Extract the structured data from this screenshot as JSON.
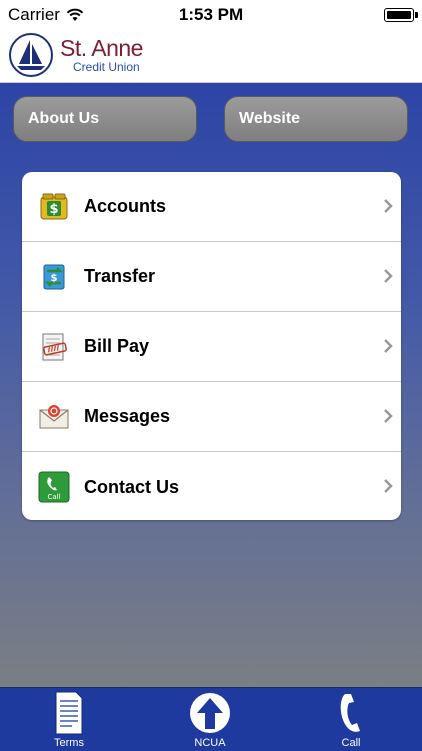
{
  "status": {
    "carrier": "Carrier",
    "time": "1:53 PM"
  },
  "header": {
    "title": "St. Anne",
    "subtitle": "Credit Union"
  },
  "buttons": {
    "about": "About Us",
    "website": "Website"
  },
  "menu": [
    {
      "label": "Accounts",
      "icon": "dollar-bag-icon"
    },
    {
      "label": "Transfer",
      "icon": "transfer-icon"
    },
    {
      "label": "Bill Pay",
      "icon": "paid-bill-icon"
    },
    {
      "label": "Messages",
      "icon": "envelope-icon"
    },
    {
      "label": "Contact Us",
      "icon": "call-icon"
    }
  ],
  "tabs": {
    "terms": "Terms",
    "ncua": "NCUA",
    "call": "Call"
  },
  "colors": {
    "brand_blue": "#1e3a9e",
    "brand_maroon": "#7a1f35"
  }
}
